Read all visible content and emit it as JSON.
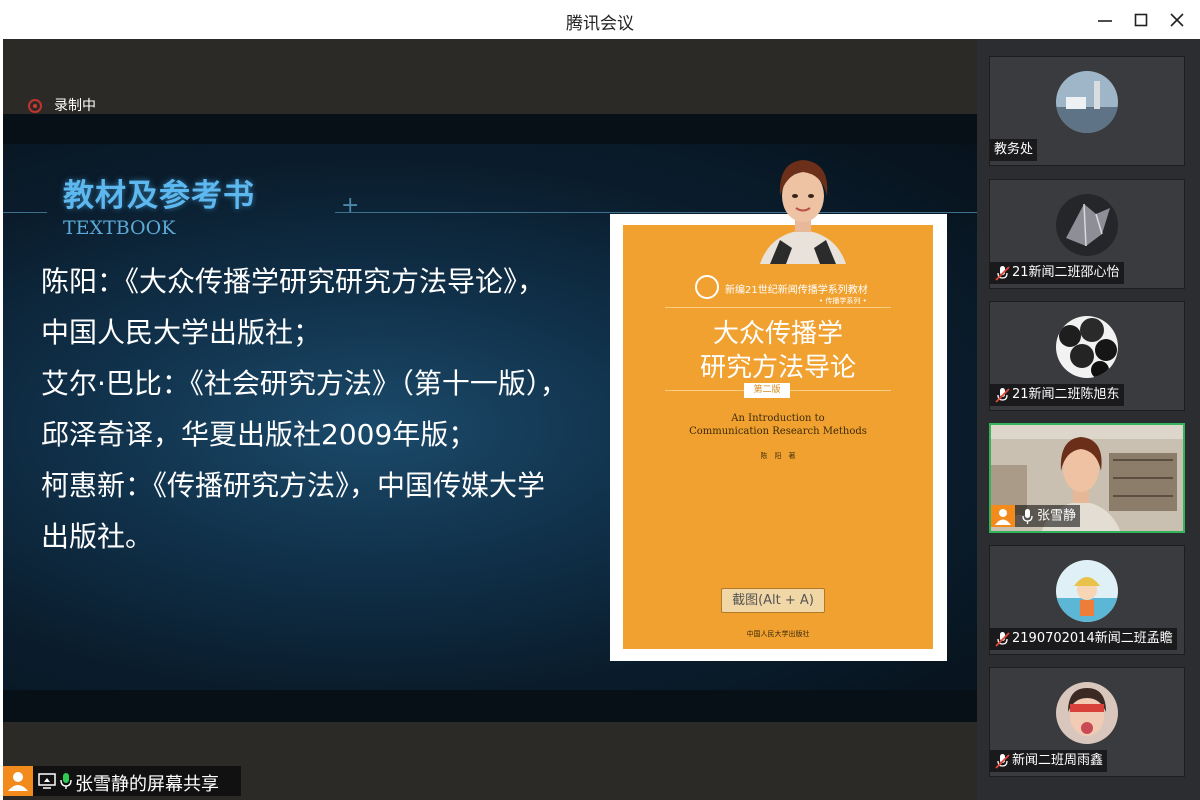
{
  "window": {
    "title": "腾讯会议"
  },
  "recording": {
    "label": "录制中"
  },
  "slide": {
    "title": "教材及参考书",
    "subtitle": "TEXTBOOK",
    "lines": [
      "陈阳：《大众传播学研究研究方法导论》，",
      "中国人民大学出版社；",
      "艾尔·巴比：《社会研究方法》（第十一版），",
      "邱泽奇译，华夏出版社2009年版；",
      "柯惠新：《传播研究方法》，中国传媒大学",
      "出版社。"
    ]
  },
  "book": {
    "series": "新编21世纪新闻传播学系列教材",
    "series_sub": "• 传播学系列 •",
    "title_line1": "大众传播学",
    "title_line2": "研究方法导论",
    "edition": "第二版",
    "english_line1": "An Introduction to",
    "english_line2": "Communication Research Methods",
    "author": "陈　阳　著",
    "publisher": "中国人民大学出版社"
  },
  "screenshot_tooltip": "截图(Alt + A)",
  "share": {
    "label": "张雪静的屏幕共享"
  },
  "participants": [
    {
      "name": "教务处",
      "muted": false,
      "mic": false,
      "avatar": "landscape"
    },
    {
      "name": "21新闻二班邵心怡",
      "muted": true,
      "mic": true,
      "avatar": "crystal"
    },
    {
      "name": "21新闻二班陈旭东",
      "muted": true,
      "mic": true,
      "avatar": "spheres"
    },
    {
      "name": "张雪静",
      "muted": false,
      "mic": true,
      "avatar": "video"
    },
    {
      "name": "2190702014新闻二班孟瞻",
      "muted": true,
      "mic": true,
      "avatar": "cartoon"
    },
    {
      "name": "新闻二班周雨鑫",
      "muted": true,
      "mic": true,
      "avatar": "portrait"
    }
  ],
  "colors": {
    "accent_active": "#33b35a",
    "title_blue": "#5cb8ee",
    "book_orange": "#f0a12f",
    "share_badge": "#f28a1c"
  }
}
